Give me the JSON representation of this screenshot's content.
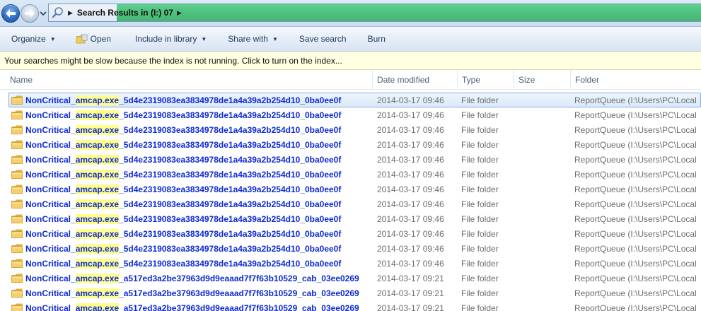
{
  "address_bar": {
    "path_text": "Search Results in (I:) 07",
    "back_icon": "back-arrow-icon",
    "forward_icon": "forward-arrow-icon",
    "search_icon": "search-icon"
  },
  "toolbar": {
    "organize": "Organize",
    "open": "Open",
    "include_in_library": "Include in library",
    "share_with": "Share with",
    "save_search": "Save search",
    "burn": "Burn"
  },
  "info_bar": {
    "message": "Your searches might be slow because the index is not running.  Click to turn on the index..."
  },
  "columns": {
    "name": "Name",
    "date_modified": "Date modified",
    "type": "Type",
    "size": "Size",
    "folder": "Folder"
  },
  "rows": [
    {
      "prefix": "NonCritical_",
      "match": "amcap.exe",
      "suffix": "_5d4e2319083ea3834978de1a4a39a2b254d10_0ba0ee0f",
      "date": "2014-03-17 09:46",
      "type": "File folder",
      "folder": "ReportQueue (I:\\Users\\PC\\Local",
      "selected": true
    },
    {
      "prefix": "NonCritical_",
      "match": "amcap.exe",
      "suffix": "_5d4e2319083ea3834978de1a4a39a2b254d10_0ba0ee0f",
      "date": "2014-03-17 09:46",
      "type": "File folder",
      "folder": "ReportQueue (I:\\Users\\PC\\Local",
      "selected": false
    },
    {
      "prefix": "NonCritical_",
      "match": "amcap.exe",
      "suffix": "_5d4e2319083ea3834978de1a4a39a2b254d10_0ba0ee0f",
      "date": "2014-03-17 09:46",
      "type": "File folder",
      "folder": "ReportQueue (I:\\Users\\PC\\Local",
      "selected": false
    },
    {
      "prefix": "NonCritical_",
      "match": "amcap.exe",
      "suffix": "_5d4e2319083ea3834978de1a4a39a2b254d10_0ba0ee0f",
      "date": "2014-03-17 09:46",
      "type": "File folder",
      "folder": "ReportQueue (I:\\Users\\PC\\Local",
      "selected": false
    },
    {
      "prefix": "NonCritical_",
      "match": "amcap.exe",
      "suffix": "_5d4e2319083ea3834978de1a4a39a2b254d10_0ba0ee0f",
      "date": "2014-03-17 09:46",
      "type": "File folder",
      "folder": "ReportQueue (I:\\Users\\PC\\Local",
      "selected": false
    },
    {
      "prefix": "NonCritical_",
      "match": "amcap.exe",
      "suffix": "_5d4e2319083ea3834978de1a4a39a2b254d10_0ba0ee0f",
      "date": "2014-03-17 09:46",
      "type": "File folder",
      "folder": "ReportQueue (I:\\Users\\PC\\Local",
      "selected": false
    },
    {
      "prefix": "NonCritical_",
      "match": "amcap.exe",
      "suffix": "_5d4e2319083ea3834978de1a4a39a2b254d10_0ba0ee0f",
      "date": "2014-03-17 09:46",
      "type": "File folder",
      "folder": "ReportQueue (I:\\Users\\PC\\Local",
      "selected": false
    },
    {
      "prefix": "NonCritical_",
      "match": "amcap.exe",
      "suffix": "_5d4e2319083ea3834978de1a4a39a2b254d10_0ba0ee0f",
      "date": "2014-03-17 09:46",
      "type": "File folder",
      "folder": "ReportQueue (I:\\Users\\PC\\Local",
      "selected": false
    },
    {
      "prefix": "NonCritical_",
      "match": "amcap.exe",
      "suffix": "_5d4e2319083ea3834978de1a4a39a2b254d10_0ba0ee0f",
      "date": "2014-03-17 09:46",
      "type": "File folder",
      "folder": "ReportQueue (I:\\Users\\PC\\Local",
      "selected": false
    },
    {
      "prefix": "NonCritical_",
      "match": "amcap.exe",
      "suffix": "_5d4e2319083ea3834978de1a4a39a2b254d10_0ba0ee0f",
      "date": "2014-03-17 09:46",
      "type": "File folder",
      "folder": "ReportQueue (I:\\Users\\PC\\Local",
      "selected": false
    },
    {
      "prefix": "NonCritical_",
      "match": "amcap.exe",
      "suffix": "_5d4e2319083ea3834978de1a4a39a2b254d10_0ba0ee0f",
      "date": "2014-03-17 09:46",
      "type": "File folder",
      "folder": "ReportQueue (I:\\Users\\PC\\Local",
      "selected": false
    },
    {
      "prefix": "NonCritical_",
      "match": "amcap.exe",
      "suffix": "_5d4e2319083ea3834978de1a4a39a2b254d10_0ba0ee0f",
      "date": "2014-03-17 09:46",
      "type": "File folder",
      "folder": "ReportQueue (I:\\Users\\PC\\Local",
      "selected": false
    },
    {
      "prefix": "NonCritical_",
      "match": "amcap.exe",
      "suffix": "_a517ed3a2be37963d9d9eaaad7f7f63b10529_cab_03ee0269",
      "date": "2014-03-17 09:21",
      "type": "File folder",
      "folder": "ReportQueue (I:\\Users\\PC\\Local",
      "selected": false
    },
    {
      "prefix": "NonCritical_",
      "match": "amcap.exe",
      "suffix": "_a517ed3a2be37963d9d9eaaad7f7f63b10529_cab_03ee0269",
      "date": "2014-03-17 09:21",
      "type": "File folder",
      "folder": "ReportQueue (I:\\Users\\PC\\Local",
      "selected": false
    },
    {
      "prefix": "NonCritical_",
      "match": "amcap.exe",
      "suffix": "_a517ed3a2be37963d9d9eaaad7f7f63b10529_cab_03ee0269",
      "date": "2014-03-17 09:21",
      "type": "File folder",
      "folder": "ReportQueue (I:\\Users\\PC\\Local",
      "selected": false
    }
  ]
}
